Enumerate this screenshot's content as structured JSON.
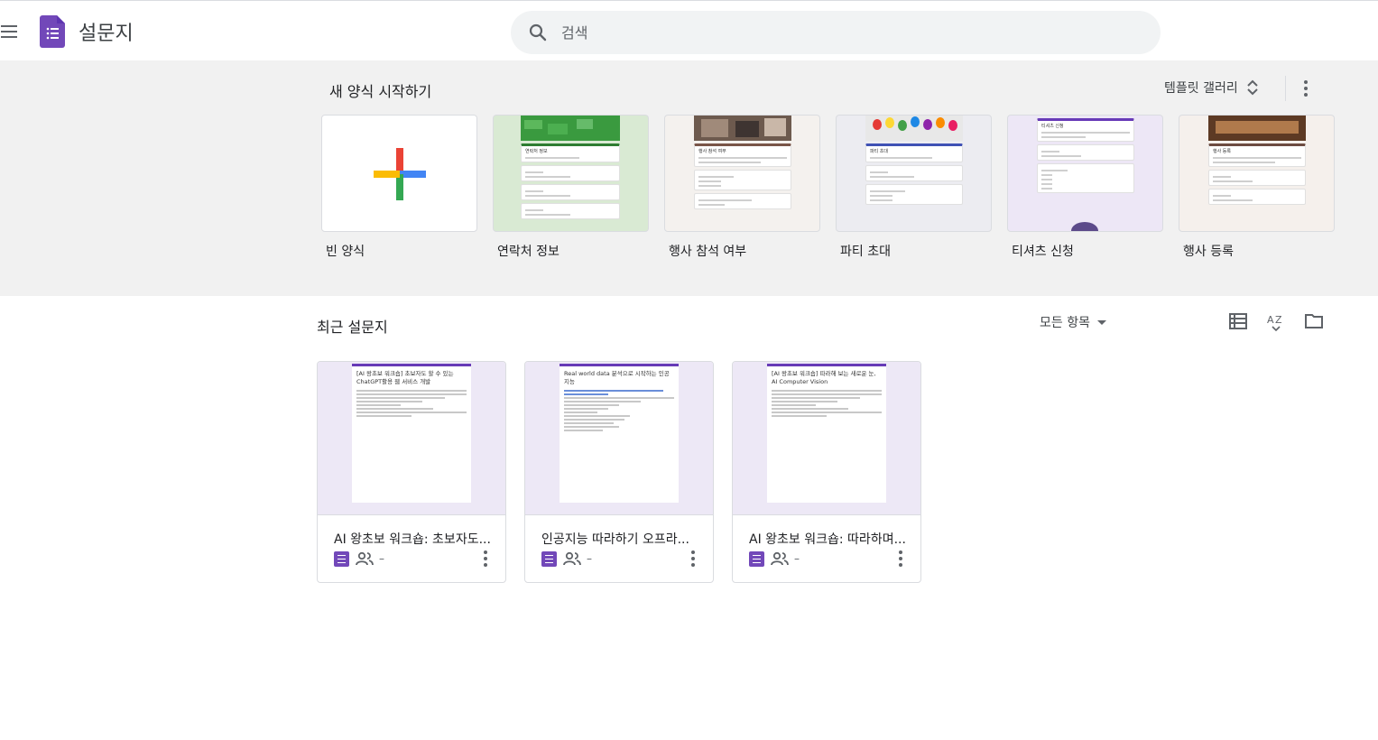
{
  "header": {
    "app_title": "설문지",
    "search_placeholder": "검색"
  },
  "templates": {
    "section_label": "새 양식 시작하기",
    "gallery_label": "템플릿 갤러리",
    "items": [
      {
        "label": "빈 양식",
        "thumb_title": ""
      },
      {
        "label": "연락처 정보",
        "thumb_title": "연락처 정보"
      },
      {
        "label": "행사 참석 여부",
        "thumb_title": "행사 참석 여부"
      },
      {
        "label": "파티 초대",
        "thumb_title": "파티 초대"
      },
      {
        "label": "티셔츠 신청",
        "thumb_title": "티셔츠 신청"
      },
      {
        "label": "행사 등록",
        "thumb_title": "행사 등록"
      }
    ]
  },
  "recent": {
    "section_label": "최근 설문지",
    "owner_filter": "모든 항목",
    "documents": [
      {
        "title": "AI 왕초보 워크숍: 초보자도...",
        "preview_title": "[AI 왕초보 워크숍] 초보자도 할 수 있는 ChatGPT활용 웹 서비스 개발",
        "shared_text": "–"
      },
      {
        "title": "인공지능 따라하기 오프라...",
        "preview_title": "Real world data 분석으로 시작하는 인공지능",
        "shared_text": "–"
      },
      {
        "title": "AI 왕초보 워크숍: 따라하며...",
        "preview_title": "[AI 왕초보 워크숍] 따라해 보는 새로운 눈, AI Computer Vision",
        "shared_text": "–"
      }
    ]
  },
  "colors": {
    "forms_purple": "#673ab7",
    "template_bg": "#f1f1f1",
    "search_bg": "#f1f3f4"
  },
  "icons": [
    "menu-icon",
    "forms-logo-icon",
    "search-icon",
    "unfold-icon",
    "more-vert-icon",
    "list-view-icon",
    "sort-az-icon",
    "folder-icon",
    "people-icon"
  ]
}
